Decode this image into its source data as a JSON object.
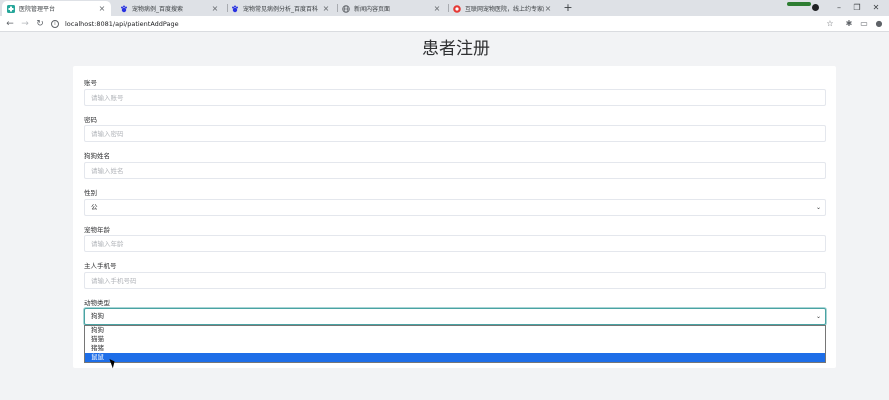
{
  "browser": {
    "tabs": [
      {
        "title": "医院管理平台",
        "active": true,
        "favicon": "hospital-icon"
      },
      {
        "title": "宠物病例_百度搜索",
        "active": false,
        "favicon": "baidu-paw-icon"
      },
      {
        "title": "宠物常见病例分析_百度百科",
        "active": false,
        "favicon": "baike-icon"
      },
      {
        "title": "新闻内容页面",
        "active": false,
        "favicon": "globe-icon"
      },
      {
        "title": "互联网宠物医院，线上约专家问",
        "active": false,
        "favicon": "pet-hospital-icon"
      }
    ],
    "url": "localhost:8081/api/patientAddPage"
  },
  "page": {
    "title": "患者注册",
    "fields": [
      {
        "label": "账号",
        "placeholder": "请输入账号"
      },
      {
        "label": "密码",
        "placeholder": "请输入密码"
      },
      {
        "label": "狗狗姓名",
        "placeholder": "请输入姓名"
      },
      {
        "label": "性别",
        "value": "公"
      },
      {
        "label": "宠物年龄",
        "placeholder": "请输入年龄"
      },
      {
        "label": "主人手机号",
        "placeholder": "请输入手机号码"
      },
      {
        "label": "动物类型",
        "value": "狗狗"
      }
    ],
    "animal_options": [
      "狗狗",
      "猫猫",
      "猪猪",
      "鼠鼠"
    ],
    "highlighted_option": "鼠鼠"
  },
  "colors": {
    "accent_focus": "#4aa3a3",
    "option_highlight": "#1e6ee8"
  }
}
